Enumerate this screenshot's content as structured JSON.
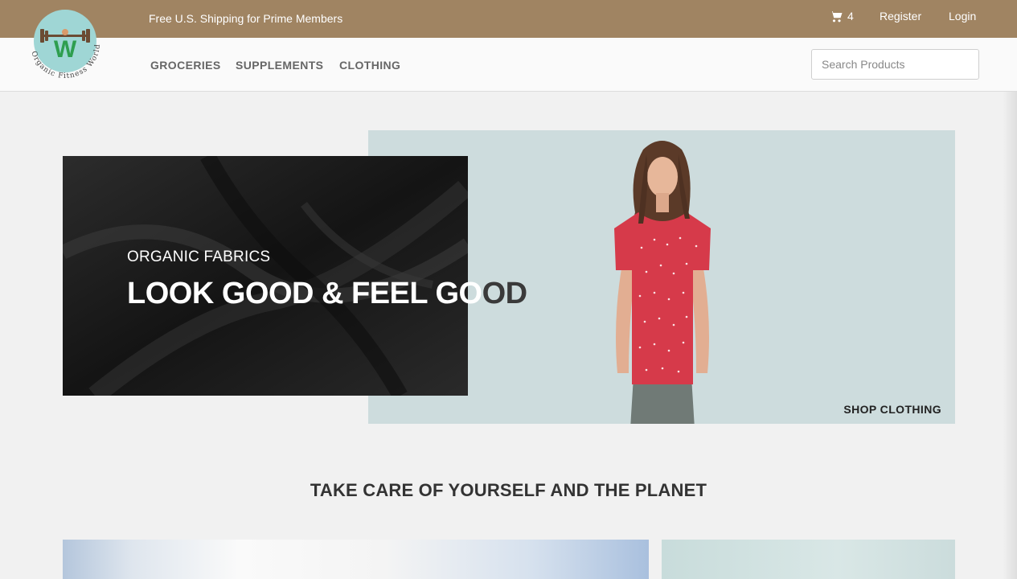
{
  "topbar": {
    "promo": "Free U.S. Shipping for Prime Members",
    "cart_count": "4",
    "register": "Register",
    "login": "Login"
  },
  "logo": {
    "text": "Organic Fitness World",
    "letter": "W"
  },
  "nav": {
    "items": [
      "GROCERIES",
      "SUPPLEMENTS",
      "CLOTHING"
    ]
  },
  "search": {
    "placeholder": "Search Products"
  },
  "hero": {
    "subtitle": "ORGANIC FABRICS",
    "title_light": "LOOK GOOD & FEEL GO",
    "title_dark": "OD",
    "cta": "SHOP CLOTHING"
  },
  "section": {
    "tagline": "TAKE CARE OF YOURSELF AND THE PLANET"
  },
  "colors": {
    "topbar": "#a08462",
    "hero_bg": "#cddcdd",
    "fabric": "#1e1e1e",
    "logo_circle": "#9fd6d5",
    "logo_letter": "#2e9e4f",
    "shirt": "#d63a4a"
  }
}
